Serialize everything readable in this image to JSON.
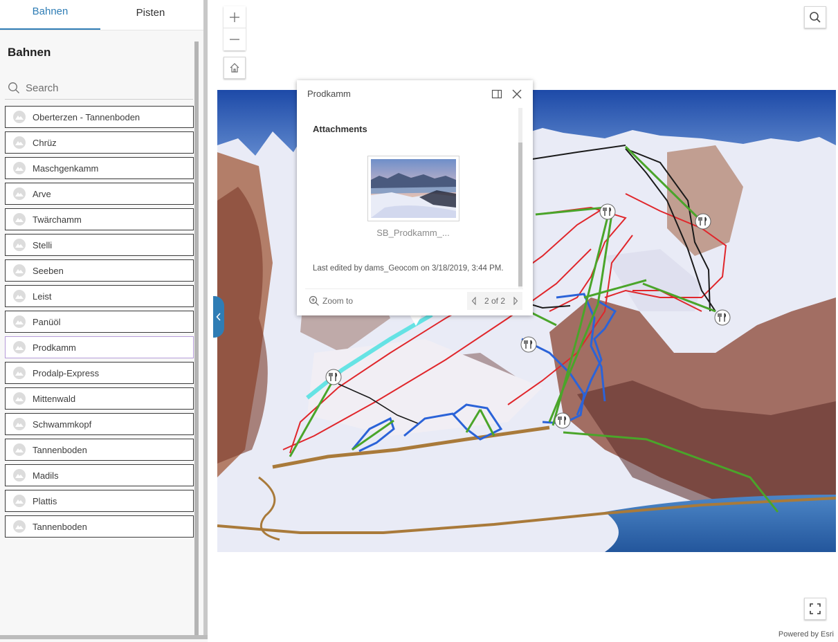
{
  "tabs": [
    {
      "label": "Bahnen",
      "active": true
    },
    {
      "label": "Pisten",
      "active": false
    }
  ],
  "panel": {
    "title": "Bahnen",
    "search_placeholder": "Search",
    "items": [
      "Oberterzen - Tannenboden",
      "Chrüz",
      "Maschgenkamm",
      "Arve",
      "Twärchamm",
      "Stelli",
      "Seeben",
      "Leist",
      "Panüöl",
      "Prodkamm",
      "Prodalp-Express",
      "Mittenwald",
      "Schwammkopf",
      "Tannenboden",
      "Madils",
      "Plattis",
      "Tannenboden"
    ],
    "selected": "Prodkamm"
  },
  "popup": {
    "title": "Prodkamm",
    "section": "Attachments",
    "attachment_name": "SB_Prodkamm_...",
    "last_edited": "Last edited by dams_Geocom on 3/18/2019, 3:44 PM.",
    "zoom_label": "Zoom to",
    "pager": "2 of 2"
  },
  "map": {
    "attribution": "Powered by Esri"
  },
  "icons": {
    "zoom_in": "plus-icon",
    "zoom_out": "minus-icon",
    "home": "home-icon",
    "search": "search-icon",
    "fullscreen": "fullscreen-icon",
    "collapse": "chevron-left-icon",
    "dock": "dock-icon",
    "close": "close-icon",
    "restaurant": "fork-knife-icon"
  },
  "colors": {
    "accent": "#2f7db5",
    "run_easy": "#2b63d8",
    "run_medium": "#e0262b",
    "run_hard": "#1a1a1a",
    "lift": "#4aa52a",
    "road": "#a97a3a"
  }
}
